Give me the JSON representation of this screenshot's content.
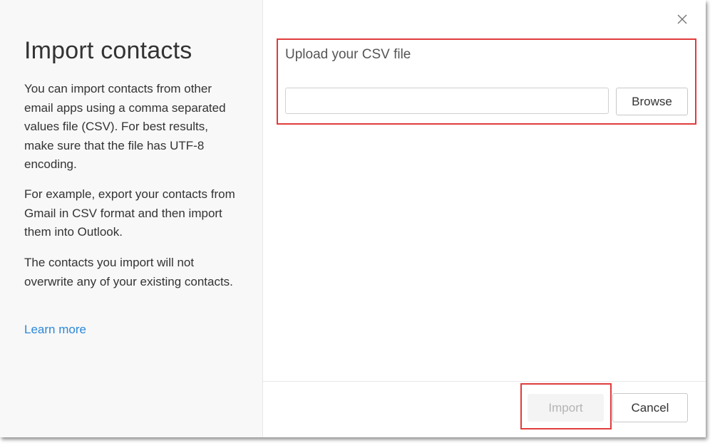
{
  "sidebar": {
    "title": "Import contacts",
    "paragraph1": "You can import contacts from other email apps using a comma separated values file (CSV). For best results, make sure that the file has UTF-8 encoding.",
    "paragraph2": "For example, export your contacts from Gmail in CSV format and then import them into Outlook.",
    "paragraph3": "The contacts you import will not overwrite any of your existing contacts.",
    "learn_more": "Learn more"
  },
  "upload": {
    "label": "Upload your CSV file",
    "file_value": "",
    "browse_label": "Browse"
  },
  "footer": {
    "import_label": "Import",
    "cancel_label": "Cancel"
  },
  "icons": {
    "close": "close-icon"
  },
  "colors": {
    "link": "#2b88d8",
    "highlight": "#e03c3c",
    "sidebar_bg": "#f8f8f8",
    "disabled_text": "#b4b4b4"
  }
}
